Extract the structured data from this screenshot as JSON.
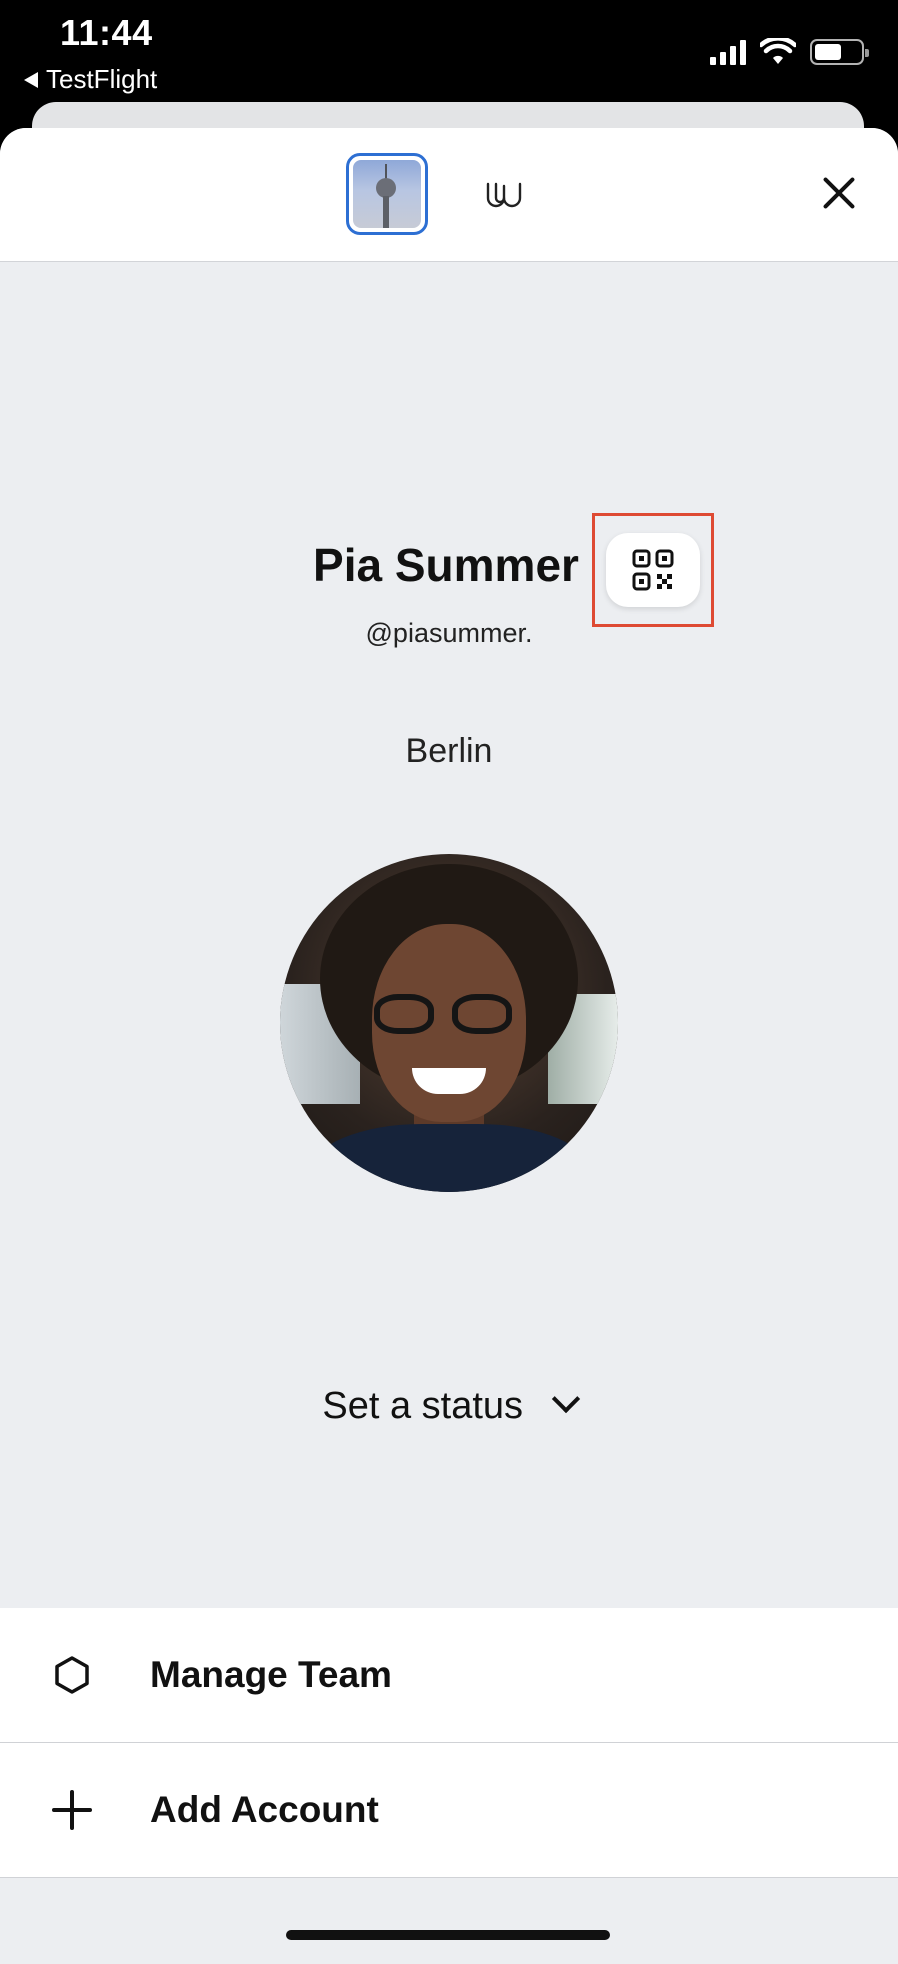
{
  "status_bar": {
    "time": "11:44",
    "back_app": "TestFlight"
  },
  "topbar": {
    "team_avatar_alt": "TV tower team avatar",
    "secondary_logo": "W",
    "close_icon": "close-icon"
  },
  "profile": {
    "name": "Pia Summer",
    "handle": "@piasummer.",
    "location": "Berlin",
    "qr_icon": "qr-code-icon",
    "status_label": "Set a status"
  },
  "menu": {
    "items": [
      {
        "label": "Manage Team",
        "icon": "hexagon-icon"
      },
      {
        "label": "Add Account",
        "icon": "plus-icon"
      }
    ]
  },
  "colors": {
    "highlight": "#de4a33",
    "accent_blue": "#2d6fd3",
    "sheet_bg": "#eceef1"
  }
}
